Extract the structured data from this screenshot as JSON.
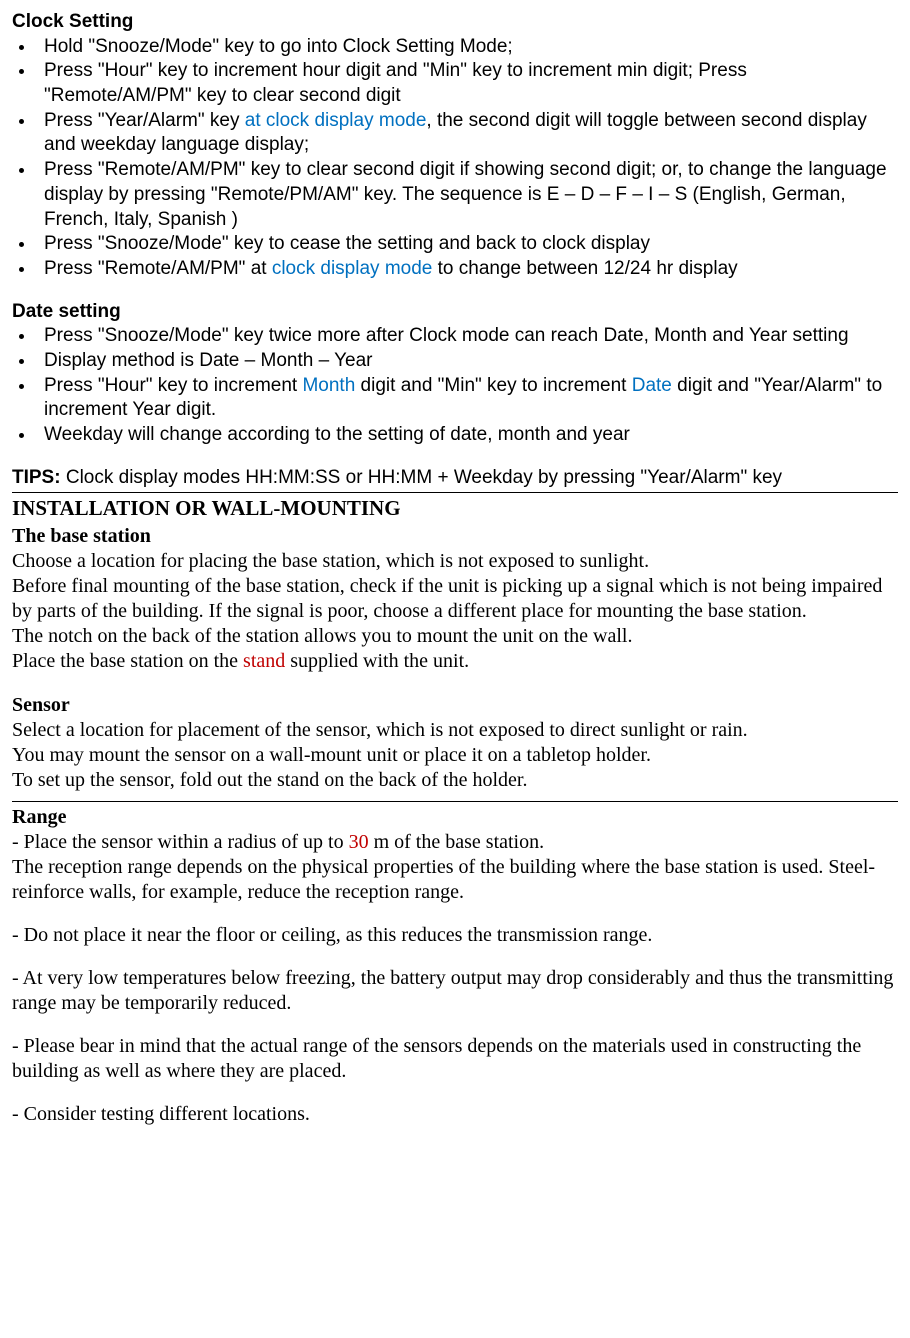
{
  "clockSetting": {
    "heading": "Clock Setting",
    "items": [
      {
        "parts": [
          {
            "text": "Hold \"Snooze/Mode\" key to go into Clock Setting Mode;"
          }
        ]
      },
      {
        "parts": [
          {
            "text": "Press \"Hour\" key to increment hour digit and \"Min\" key to increment min digit; Press \"Remote/AM/PM\" key to clear second digit"
          }
        ]
      },
      {
        "parts": [
          {
            "text": "Press \"Year/Alarm\" key "
          },
          {
            "text": "at clock display mode",
            "class": "blue"
          },
          {
            "text": ", the second digit will toggle between second display and weekday language display;"
          }
        ]
      },
      {
        "parts": [
          {
            "text": "Press \"Remote/AM/PM\" key to clear second digit if showing second digit; or, to change the language display by pressing \"Remote/PM/AM\" key. The sequence is E – D – F – I – S (English, German, French, Italy, Spanish )"
          }
        ]
      },
      {
        "parts": [
          {
            "text": "Press \"Snooze/Mode\" key to cease the setting and back to clock display"
          }
        ]
      },
      {
        "parts": [
          {
            "text": "Press \"Remote/AM/PM\" at "
          },
          {
            "text": "clock display mode",
            "class": "blue"
          },
          {
            "text": " to change between 12/24 hr display"
          }
        ]
      }
    ]
  },
  "dateSetting": {
    "heading": "Date setting",
    "items": [
      {
        "parts": [
          {
            "text": "Press \"Snooze/Mode\" key twice more after Clock mode can reach Date, Month and Year setting"
          }
        ]
      },
      {
        "parts": [
          {
            "text": "Display method is Date – Month – Year"
          }
        ]
      },
      {
        "parts": [
          {
            "text": "Press \"Hour\" key to increment "
          },
          {
            "text": "Month",
            "class": "blue"
          },
          {
            "text": " digit and \"Min\" key to increment "
          },
          {
            "text": "Date",
            "class": "blue"
          },
          {
            "text": " digit and \"Year/Alarm\" to increment Year digit."
          }
        ]
      },
      {
        "parts": [
          {
            "text": "Weekday will change according to the setting of date, month and year"
          }
        ]
      }
    ]
  },
  "tips": {
    "label": "TIPS:",
    "text": " Clock display modes HH:MM:SS or HH:MM + Weekday by pressing \"Year/Alarm\" key"
  },
  "installation": {
    "heading": "INSTALLATION OR WALL-MOUNTING",
    "baseStation": {
      "heading": "The base station",
      "para1": "Choose a location for placing the base station, which is not exposed to sunlight.",
      "para2": "Before final mounting of the base station, check if the unit is picking up a signal which is not being impaired by parts of the building. If the signal is poor, choose a different place for mounting the base station.",
      "para3": "The notch on the back of the station allows you to mount the unit on the wall.",
      "para4_a": "Place the base station on the ",
      "para4_b": "stand",
      "para4_c": " supplied with the unit."
    },
    "sensor": {
      "heading": "Sensor",
      "para1": "Select a location for placement of the sensor, which is not exposed to direct sunlight or rain.",
      "para2": "You may mount the sensor on a wall-mount unit or place it on a tabletop holder.",
      "para3": "To set up the sensor, fold out the stand on the back of the holder."
    }
  },
  "range": {
    "heading": "Range",
    "p1_a": "- Place the sensor within a radius of up to ",
    "p1_b": "30",
    "p1_c": " m of the base station.",
    "p2": "The reception range depends on the physical properties of the building where the base station is used. Steel-reinforce walls, for example, reduce the reception range.",
    "p3": "- Do not place it near the floor or ceiling, as this reduces the transmission range.",
    "p4": "- At very low temperatures below freezing, the battery output may drop considerably and thus the transmitting range may be temporarily reduced.",
    "p5": "- Please bear in mind that the actual range of the sensors depends on the materials used in constructing the building as well as where they are placed.",
    "p6": "- Consider testing different locations."
  }
}
